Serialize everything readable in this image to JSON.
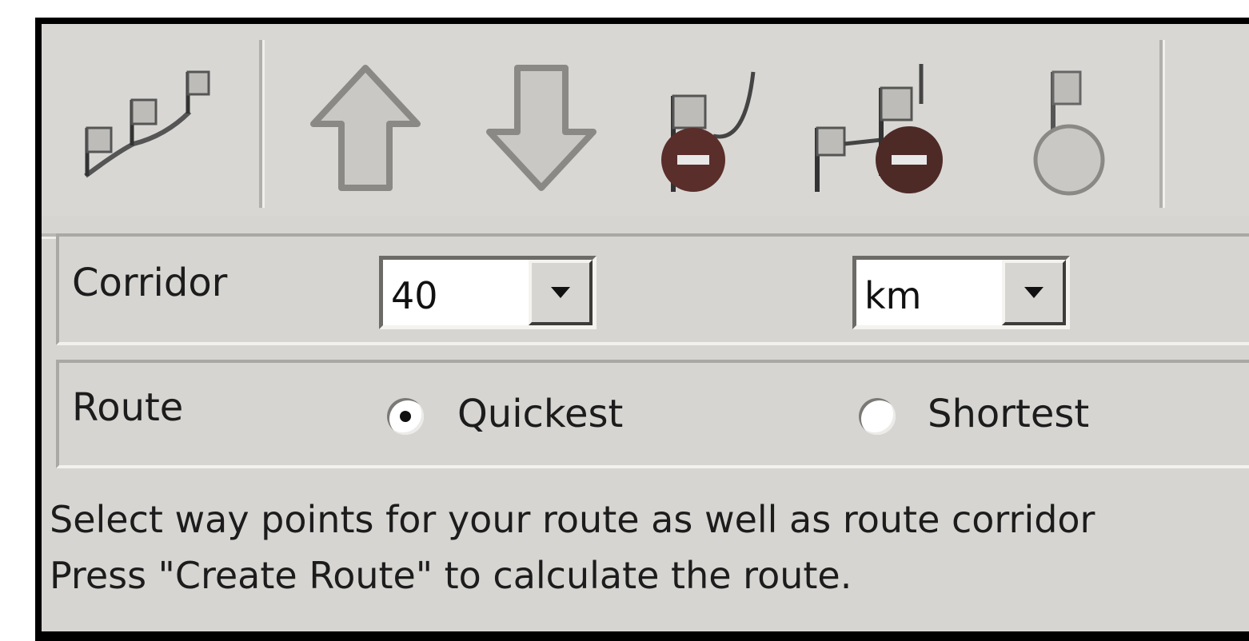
{
  "toolbar": {
    "buttons": [
      {
        "name": "route-flags-icon"
      },
      {
        "name": "move-up-icon"
      },
      {
        "name": "move-down-icon"
      },
      {
        "name": "remove-start-flag-icon"
      },
      {
        "name": "remove-waypoint-flag-icon"
      },
      {
        "name": "remove-end-flag-icon"
      }
    ]
  },
  "corridor": {
    "label": "Corridor",
    "distance_value": "40",
    "unit_value": "km"
  },
  "route": {
    "label": "Route",
    "options": [
      {
        "label": "Quickest",
        "selected": true
      },
      {
        "label": "Shortest",
        "selected": false
      }
    ]
  },
  "status": {
    "line1": "Select way points for your route as well as route corridor",
    "line2": "Press \"Create Route\" to calculate the route."
  },
  "colors": {
    "panel_bg": "#d6d5d2",
    "remove_badge": "#5a2e2a",
    "icon_fill": "#c9c8c5"
  }
}
